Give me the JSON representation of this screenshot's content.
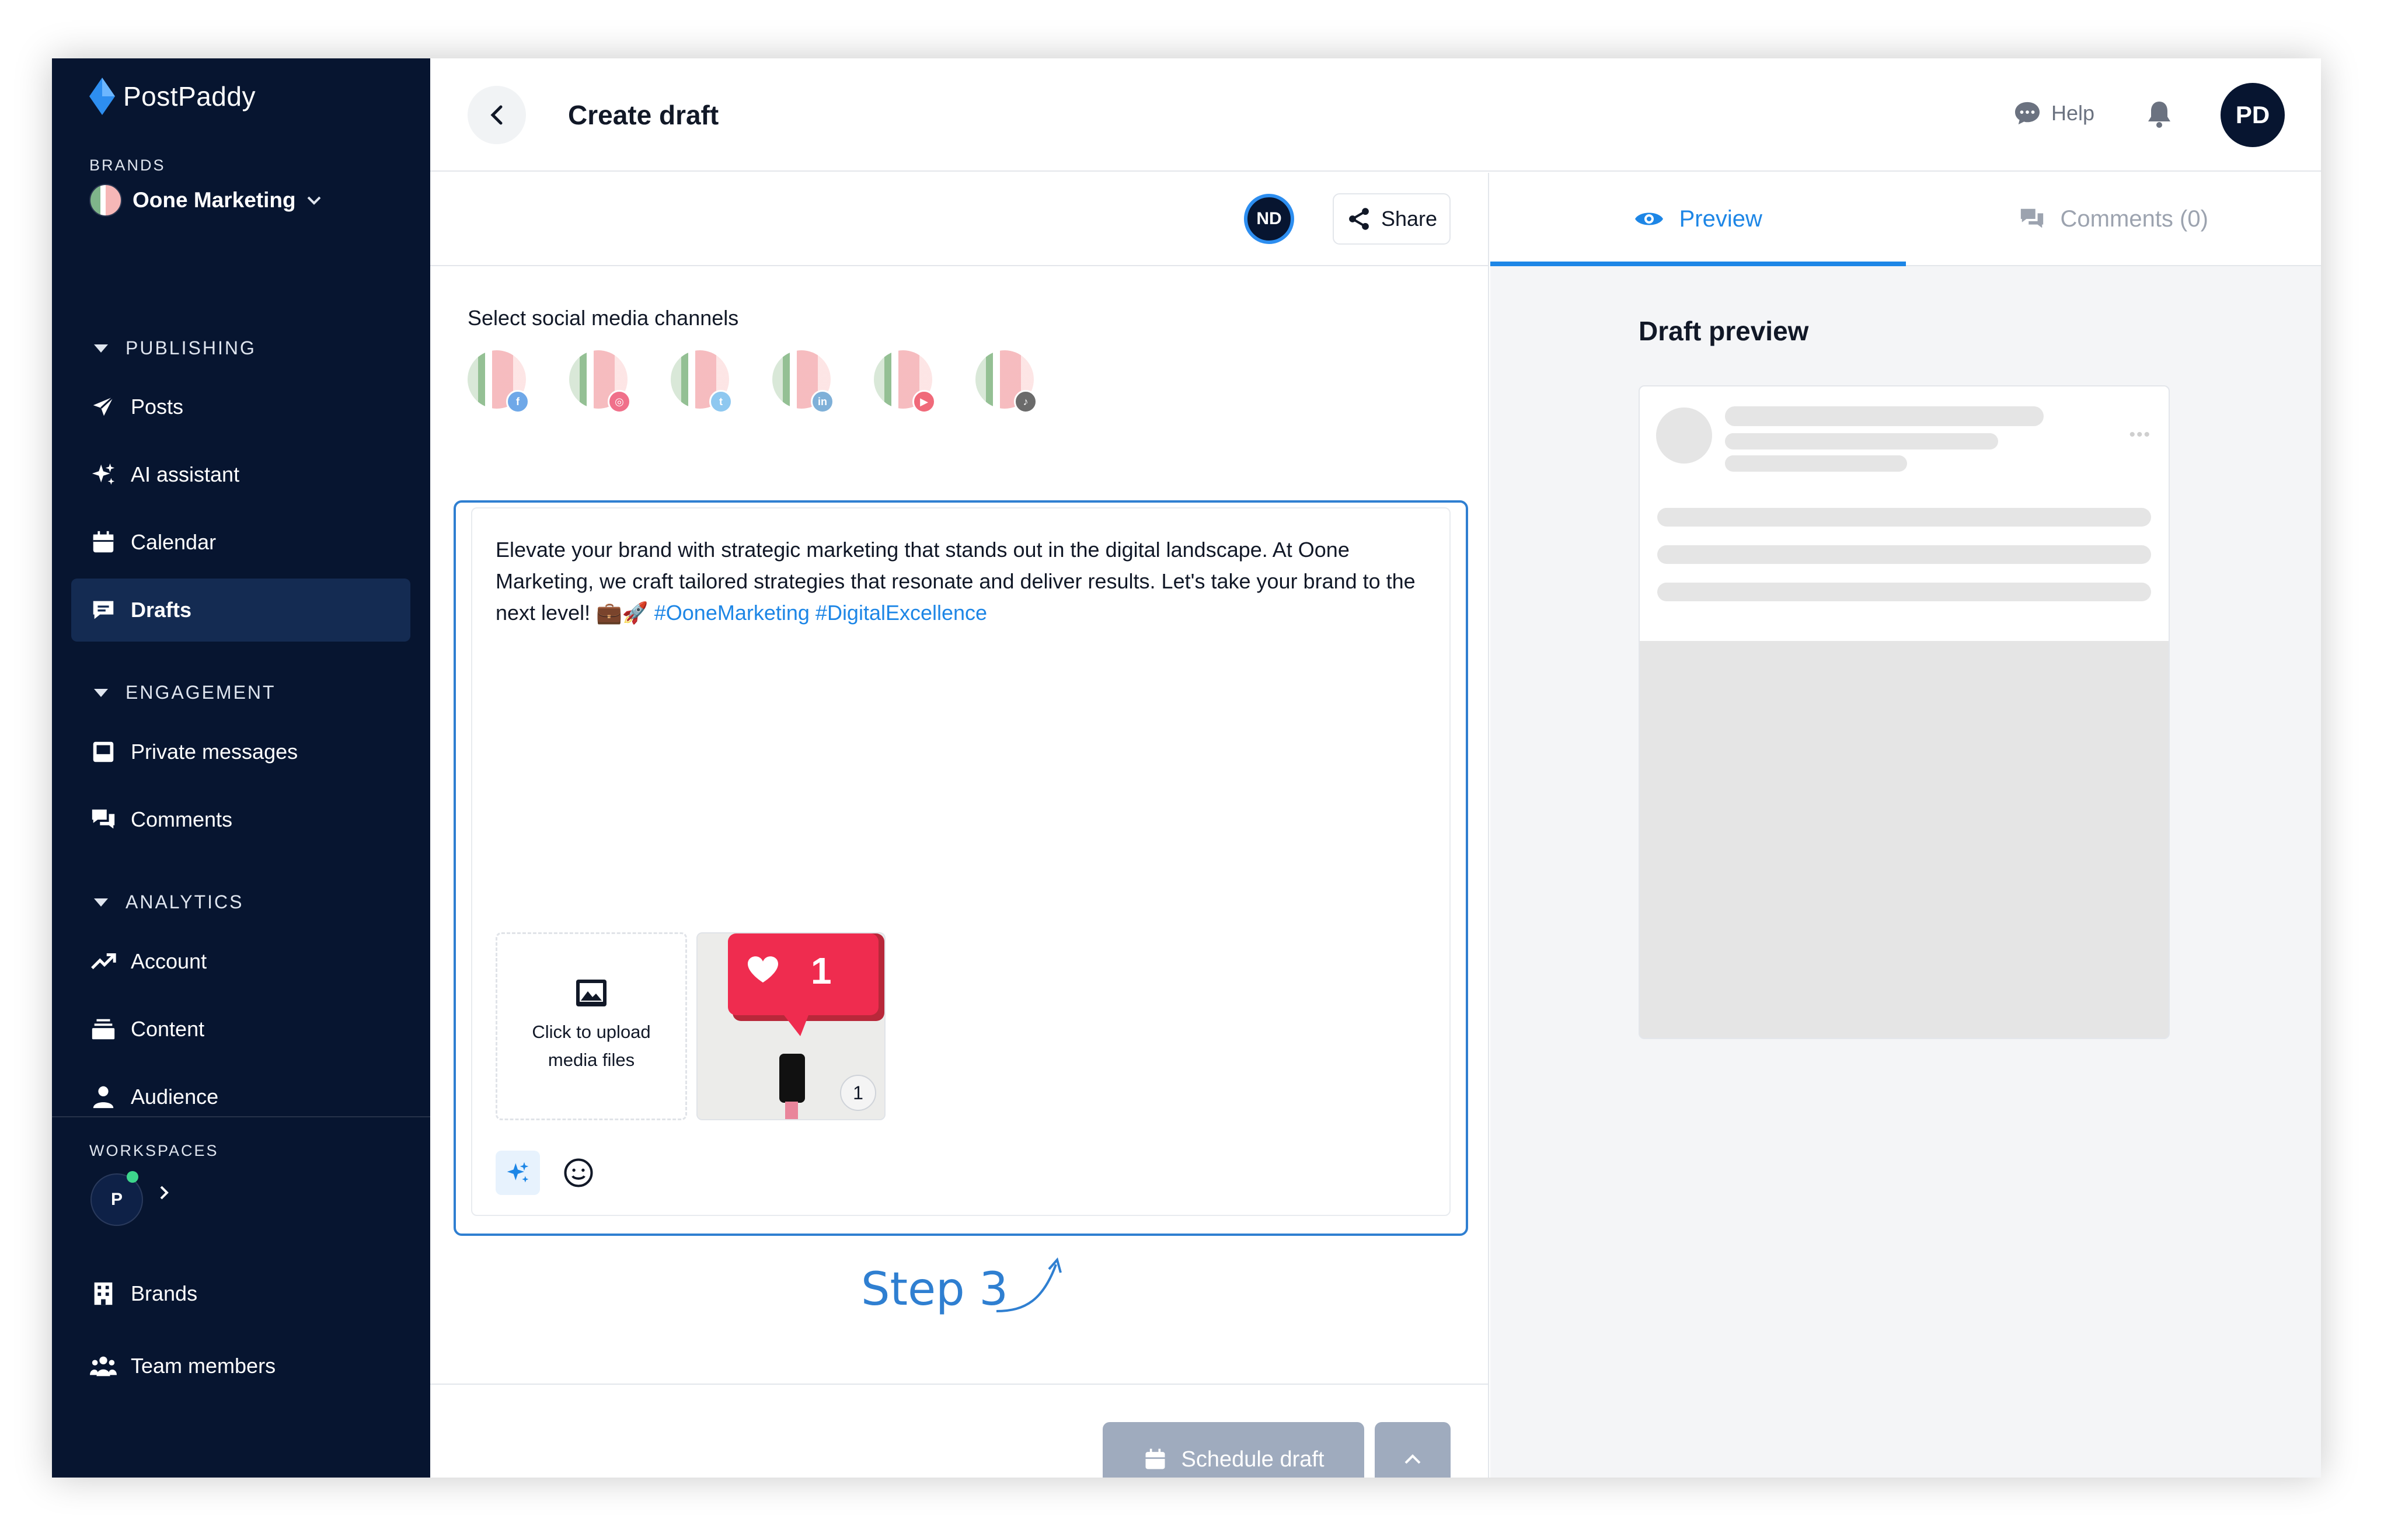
{
  "app": {
    "name": "PostPaddy",
    "accent_color": "#1d86e6",
    "sidebar_color": "#071530"
  },
  "sidebar": {
    "brands_label": "BRANDS",
    "brand_name": "Oone Marketing",
    "groups": [
      {
        "label": "PUBLISHING",
        "items": [
          {
            "label": "Posts",
            "icon": "send-icon"
          },
          {
            "label": "AI assistant",
            "icon": "sparkles-icon"
          },
          {
            "label": "Calendar",
            "icon": "calendar-icon"
          },
          {
            "label": "Drafts",
            "icon": "drafts-icon",
            "active": true
          }
        ]
      },
      {
        "label": "ENGAGEMENT",
        "items": [
          {
            "label": "Private messages",
            "icon": "inbox-icon"
          },
          {
            "label": "Comments",
            "icon": "chat-bubbles-icon"
          }
        ]
      },
      {
        "label": "ANALYTICS",
        "items": [
          {
            "label": "Account",
            "icon": "trend-up-icon"
          },
          {
            "label": "Content",
            "icon": "stack-icon"
          },
          {
            "label": "Audience",
            "icon": "person-icon"
          }
        ]
      }
    ],
    "workspaces_label": "WORKSPACES",
    "workspace_initial": "P",
    "bottom_items": [
      {
        "label": "Brands",
        "icon": "building-icon"
      },
      {
        "label": "Team members",
        "icon": "team-icon"
      }
    ]
  },
  "header": {
    "title": "Create draft",
    "help_label": "Help",
    "user_initials": "PD"
  },
  "editor": {
    "collaborator_initials": "ND",
    "share_label": "Share",
    "channels_label": "Select social media channels",
    "channels": [
      {
        "network": "facebook",
        "badge_color": "#6fa8e8",
        "glyph": "f"
      },
      {
        "network": "instagram",
        "badge_color": "#f0708a",
        "glyph": "◎"
      },
      {
        "network": "twitter",
        "badge_color": "#8ec8f0",
        "glyph": "t"
      },
      {
        "network": "linkedin",
        "badge_color": "#7fb0d8",
        "glyph": "in"
      },
      {
        "network": "youtube",
        "badge_color": "#f06a7a",
        "glyph": "▶"
      },
      {
        "network": "tiktok",
        "badge_color": "#6b6b6b",
        "glyph": "♪"
      }
    ],
    "post_text": "Elevate your brand with strategic marketing that stands out in the digital landscape. At Oone Marketing, we craft tailored strategies that resonate and deliver results. Let's take your brand to the next level! 💼🚀",
    "hashtags": "#OoneMarketing #DigitalExcellence",
    "upload_line1": "Click to upload",
    "upload_line2": "media files",
    "media_count": "1",
    "step_label": "Step 3",
    "schedule_label": "Schedule draft"
  },
  "preview": {
    "tab_preview": "Preview",
    "tab_comments": "Comments (0)",
    "title": "Draft preview"
  }
}
